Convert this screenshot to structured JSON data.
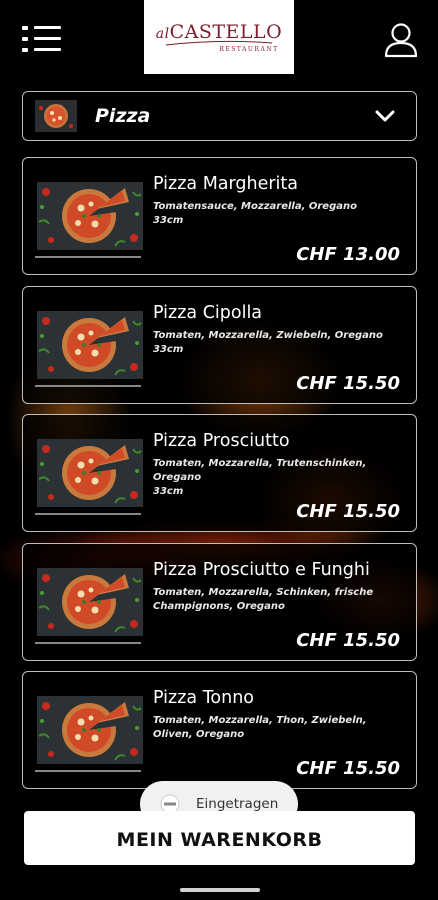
{
  "header": {
    "menu_icon": "hamburger-list-icon",
    "logo": {
      "prefix": "al",
      "name": "CASTELLO",
      "tagline": "RESTAURANT"
    },
    "user_icon": "user-profile-icon"
  },
  "category": {
    "label": "Pizza",
    "icon": "chevron-down-icon"
  },
  "items": [
    {
      "title": "Pizza Margherita",
      "desc": "Tomatensauce, Mozzarella, Oregano",
      "size": "33cm",
      "price": "CHF 13.00"
    },
    {
      "title": "Pizza Cipolla",
      "desc": "Tomaten, Mozzarella, Zwiebeln, Oregano",
      "size": "33cm",
      "price": "CHF 15.50"
    },
    {
      "title": "Pizza Prosciutto",
      "desc": "Tomaten, Mozzarella, Trutenschinken, Oregano",
      "size": "33cm",
      "price": "CHF 15.50"
    },
    {
      "title": "Pizza Prosciutto e Funghi",
      "desc": "Tomaten, Mozzarella, Schinken, frische Champignons, Oregano",
      "size": "",
      "price": "CHF 15.50"
    },
    {
      "title": "Pizza Tonno",
      "desc": "Tomaten, Mozzarella, Thon, Zwiebeln, Oliven, Oregano",
      "size": "",
      "price": "CHF 15.50"
    }
  ],
  "toast": {
    "text": "Eingetragen"
  },
  "cart_button": {
    "label": "MEIN WARENKORB"
  },
  "colors": {
    "background": "#000000",
    "logo_red": "#7a1f2b",
    "border": "#bdbdbd"
  }
}
